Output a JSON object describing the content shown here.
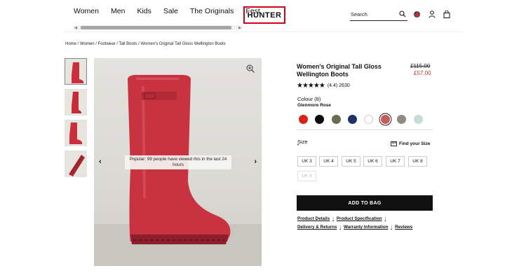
{
  "header": {
    "nav": [
      "Women",
      "Men",
      "Kids",
      "Sale",
      "The Originals",
      "Fest"
    ],
    "logo": "HUNTER",
    "search_placeholder": "Search",
    "icons": [
      "search-icon",
      "flag-icon",
      "user-icon",
      "bag-icon"
    ]
  },
  "breadcrumb": "Home / Women / Footwear / Tall Boots / Women's Original Tall Gloss Wellington Boots",
  "gallery": {
    "popular_text": "Popular: 99 people have viewed this in the last 24 hours",
    "prev": "‹",
    "next": "›"
  },
  "product": {
    "title": "Women's Original Tall Gloss Wellington Boots",
    "price_old": "£115.00",
    "price_new": "£57.00",
    "rating_stars": "★★★★★",
    "rating_text": "(4.4) 2630",
    "rating_value": 4.4,
    "colour_label": "Colour (8)",
    "colour_name": "Glenmore Rose",
    "swatches": [
      "#d62418",
      "#0c0c0c",
      "#6a6d4d",
      "#1f3466",
      "#ffffff",
      "#c45c58",
      "#8d8b82",
      "#c4ddd6"
    ],
    "selected_swatch": 5,
    "size_label": "Size",
    "size_dot": "•",
    "find_size": "Find your Size",
    "sizes": [
      "UK 3",
      "UK 4",
      "UK 5",
      "UK 6",
      "UK 7",
      "UK 8",
      "UK 9"
    ],
    "add_to_bag": "ADD TO BAG",
    "links_row1": [
      "Product Details",
      "Product Specification"
    ],
    "links_row2": [
      "Delivery & Returns",
      "Warranty Information",
      "Reviews"
    ]
  },
  "colors": {
    "accent_red": "#c0392b",
    "logo_outline": "#d0021b"
  }
}
